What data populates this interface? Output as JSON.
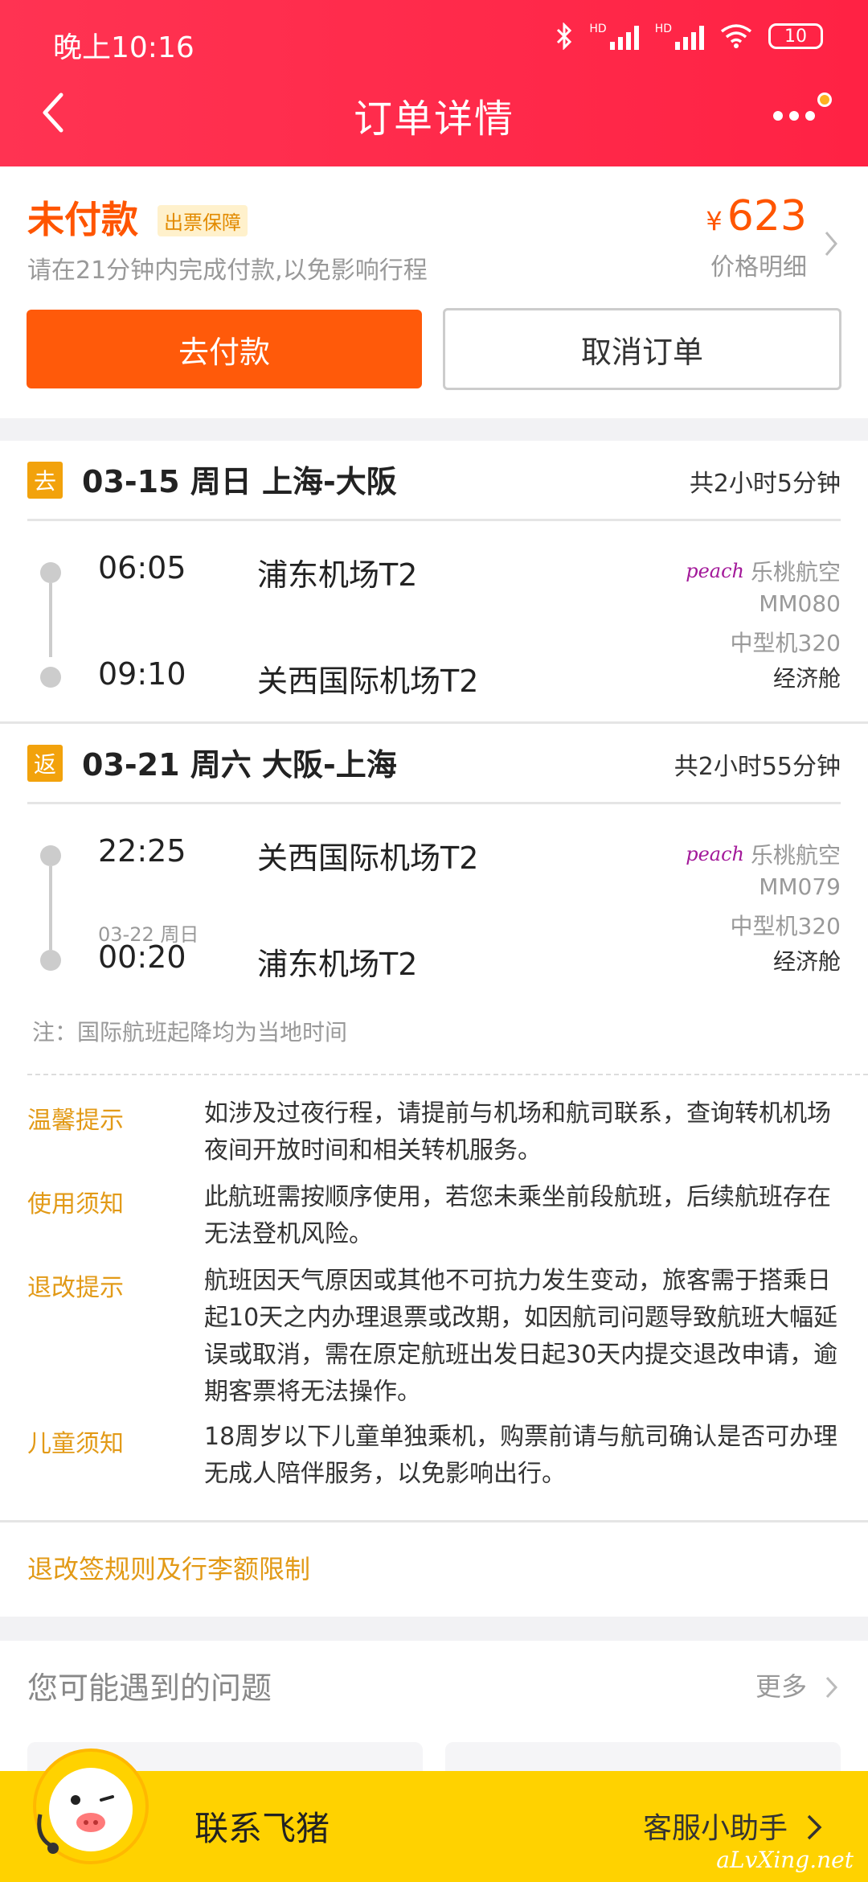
{
  "status_bar": {
    "time": "晚上10:16",
    "hd1": "HD",
    "hd2": "HD",
    "battery": "10"
  },
  "header": {
    "title": "订单详情"
  },
  "payment": {
    "status": "未付款",
    "guarantee_badge": "出票保障",
    "hint": "请在21分钟内完成付款,以免影响行程",
    "currency": "¥",
    "price": "623",
    "price_detail": "价格明细",
    "pay_button": "去付款",
    "cancel_button": "取消订单"
  },
  "segments": [
    {
      "tag": "去",
      "title": "03-15 周日 上海-大阪",
      "duration": "共2小时5分钟",
      "dep_time": "06:05",
      "dep_airport": "浦东机场T2",
      "arr_time": "09:10",
      "arr_airport": "关西国际机场T2",
      "arr_date_note": "",
      "airline_logo": "peach",
      "airline": "乐桃航空",
      "flight_no": "MM080",
      "aircraft": "中型机320",
      "cabin": "经济舱"
    },
    {
      "tag": "返",
      "title": "03-21 周六 大阪-上海",
      "duration": "共2小时55分钟",
      "dep_time": "22:25",
      "dep_airport": "关西国际机场T2",
      "arr_time": "00:20",
      "arr_airport": "浦东机场T2",
      "arr_date_note": "03-22 周日",
      "airline_logo": "peach",
      "airline": "乐桃航空",
      "flight_no": "MM079",
      "aircraft": "中型机320",
      "cabin": "经济舱"
    }
  ],
  "note": "注：国际航班起降均为当地时间",
  "tips": [
    {
      "label": "温馨提示",
      "text": "如涉及过夜行程，请提前与机场和航司联系，查询转机机场夜间开放时间和相关转机服务。"
    },
    {
      "label": "使用须知",
      "text": "此航班需按顺序使用，若您未乘坐前段航班，后续航班存在无法登机风险。"
    },
    {
      "label": "退改提示",
      "text": "航班因天气原因或其他不可抗力发生变动，旅客需于搭乘日起10天之内办理退票或改期，如因航司问题导致航班大幅延误或取消，需在原定航班出发日起30天内提交退改申请，逾期客票将无法操作。"
    },
    {
      "label": "儿童须知",
      "text": "18周岁以下儿童单独乘机，购票前请与航司确认是否可办理无成人陪伴服务，以免影响出行。"
    }
  ],
  "rules_link": "退改签规则及行李额限制",
  "faq": {
    "title": "您可能遇到的问题",
    "more": "更多"
  },
  "contact": {
    "label": "联系飞猪",
    "service": "客服小助手"
  },
  "watermark": "aLvXing.net",
  "colors": {
    "header": "#ff2a48",
    "accent": "#ff5a0a",
    "tag": "#f2a20c",
    "tip_label": "#e29a17",
    "contact_bar": "#ffd200"
  }
}
